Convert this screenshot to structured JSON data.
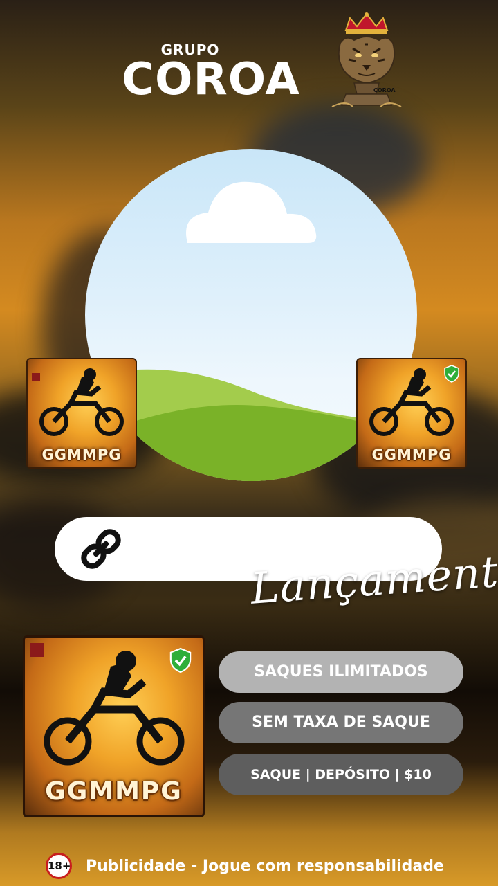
{
  "brand": {
    "small": "GRUPO",
    "big": "COROA",
    "logo_caption": "COROA",
    "logo_icon": "crowned-tiger-logo"
  },
  "image_placeholder": {
    "icon": "landscape-placeholder"
  },
  "games": {
    "left": {
      "label": "GGMMPG"
    },
    "right": {
      "label": "GGMMPG",
      "badge_icon": "verified-shield-icon"
    },
    "featured": {
      "label": "GGMMPG",
      "badge_icon": "verified-shield-icon"
    }
  },
  "link_bar": {
    "icon": "link-icon"
  },
  "launch_text": "Lançamento",
  "features": [
    "SAQUES ILIMITADOS",
    "SEM TAXA DE SAQUE",
    "SAQUE | DEPÓSITO | $10"
  ],
  "footer": {
    "age_badge": "18+",
    "text": "Publicidade - Jogue com responsabilidade"
  },
  "colors": {
    "pill_light": "#b3b3b3",
    "pill_mid": "#767676",
    "pill_dark": "#5e5e5e",
    "age_ring": "#c81e1e",
    "sky": "#c9e6f8",
    "grass": "#7ab228"
  }
}
